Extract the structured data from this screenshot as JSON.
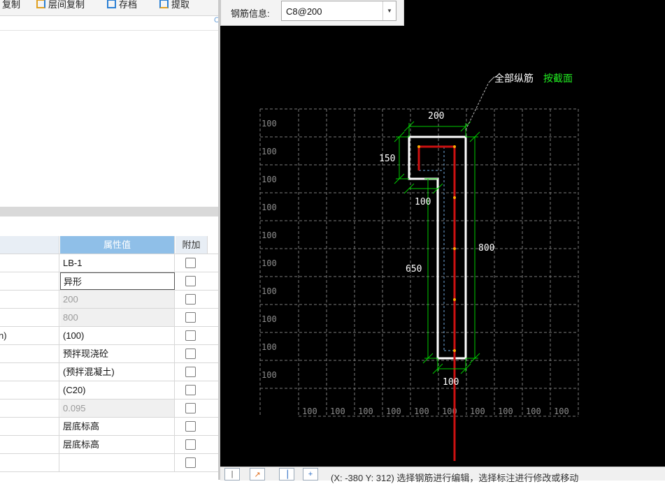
{
  "toolbar": {
    "copy_label": "复制",
    "floor_copy_label": "层间复制",
    "save_label": "存档",
    "extract_label": "提取"
  },
  "prop_table": {
    "header_value": "属性值",
    "header_add": "附加",
    "rows": [
      {
        "name": "",
        "value": "LB-1",
        "style": "normal"
      },
      {
        "name": "",
        "value": "异形",
        "style": "selected"
      },
      {
        "name": "",
        "value": "200",
        "style": "gray"
      },
      {
        "name": "",
        "value": "800",
        "style": "gray"
      },
      {
        "name": "n)",
        "value": "(100)",
        "style": "normal"
      },
      {
        "name": "",
        "value": "预拌现浇砼",
        "style": "normal"
      },
      {
        "name": "",
        "value": "(预拌混凝土)",
        "style": "normal"
      },
      {
        "name": "",
        "value": "(C20)",
        "style": "normal"
      },
      {
        "name": "",
        "value": "0.095",
        "style": "gray"
      },
      {
        "name": "",
        "value": "层底标高",
        "style": "normal"
      },
      {
        "name": "",
        "value": "层底标高",
        "style": "normal"
      },
      {
        "name": "",
        "value": "",
        "style": "normal"
      }
    ]
  },
  "rebar_info": {
    "label": "钢筋信息:",
    "value": "C8@200"
  },
  "annotation": {
    "all_longitudinal": "全部纵筋",
    "by_section": "按截面"
  },
  "dimensions": {
    "top_width": "200",
    "top_height": "150",
    "step": "100",
    "stem_height": "650",
    "total_height": "800",
    "bottom_width": "100"
  },
  "grid": {
    "left_labels": [
      "100",
      "100",
      "100",
      "100",
      "100",
      "100",
      "100",
      "100",
      "100",
      "100"
    ],
    "bottom_labels": [
      "100",
      "100",
      "100",
      "100",
      "100",
      "100",
      "100",
      "100",
      "100",
      "100"
    ]
  },
  "status_bar": {
    "text": "(X: -380 Y: 312) 选择钢筋进行编辑，选择标注进行修改或移动"
  },
  "colors": {
    "canvas_bg": "#000000",
    "outline": "#ffffff",
    "dimension": "#00cc00",
    "rebar": "#cc1111",
    "grid": "#7a7a7a",
    "header_blue": "#8fbfe8"
  }
}
